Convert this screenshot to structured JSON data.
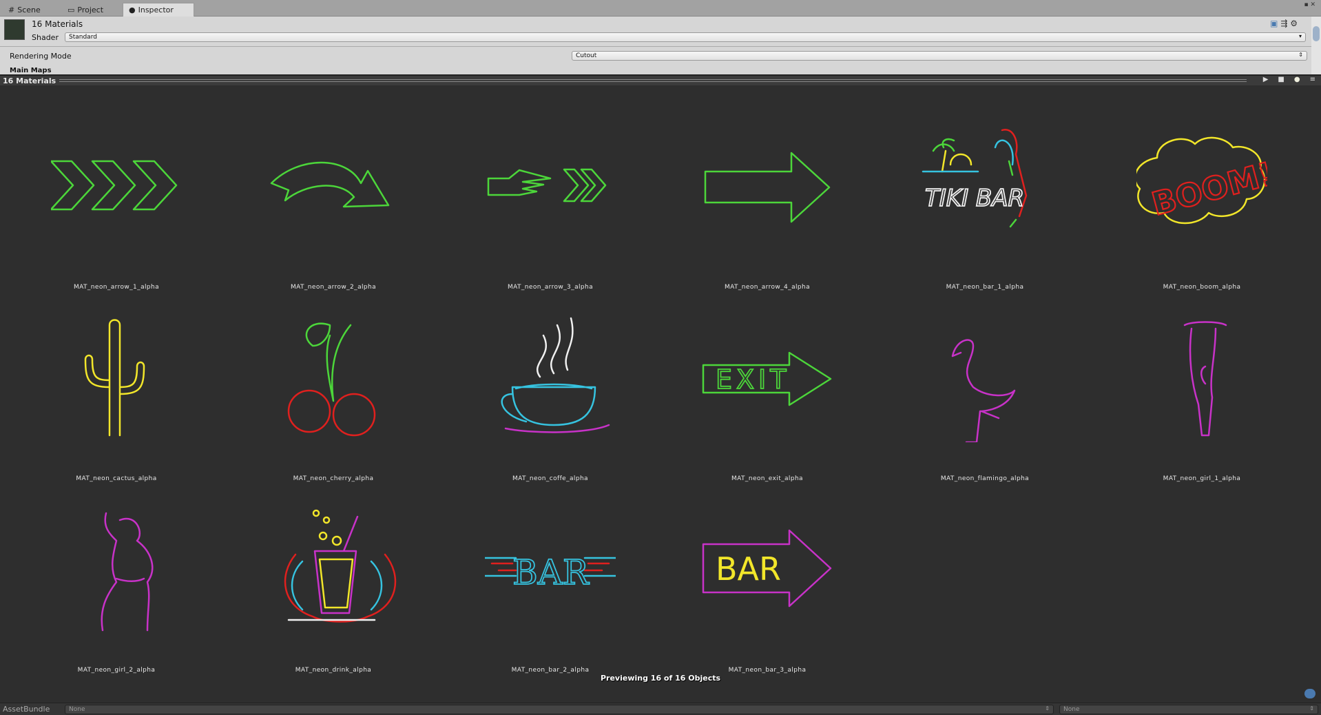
{
  "tabs": [
    {
      "label": "Scene",
      "icon": "hash-icon"
    },
    {
      "label": "Project",
      "icon": "folder-icon"
    },
    {
      "label": "Inspector",
      "icon": "info-icon"
    }
  ],
  "inspector": {
    "title": "16 Materials",
    "shader_label": "Shader",
    "shader_value": "Standard",
    "rendering_mode_label": "Rendering Mode",
    "rendering_mode_value": "Cutout",
    "section": "Main Maps"
  },
  "preview": {
    "title": "16 Materials",
    "footer": "Previewing 16 of 16 Objects"
  },
  "materials": [
    {
      "name": "MAT_neon_arrow_1_alpha"
    },
    {
      "name": "MAT_neon_arrow_2_alpha"
    },
    {
      "name": "MAT_neon_arrow_3_alpha"
    },
    {
      "name": "MAT_neon_arrow_4_alpha"
    },
    {
      "name": "MAT_neon_bar_1_alpha",
      "text": "TIKI BAR"
    },
    {
      "name": "MAT_neon_boom_alpha",
      "text": "BOOM!"
    },
    {
      "name": "MAT_neon_cactus_alpha"
    },
    {
      "name": "MAT_neon_cherry_alpha"
    },
    {
      "name": "MAT_neon_coffe_alpha"
    },
    {
      "name": "MAT_neon_exit_alpha",
      "text": "EXIT"
    },
    {
      "name": "MAT_neon_flamingo_alpha"
    },
    {
      "name": "MAT_neon_girl_1_alpha"
    },
    {
      "name": "MAT_neon_girl_2_alpha"
    },
    {
      "name": "MAT_neon_drink_alpha"
    },
    {
      "name": "MAT_neon_bar_2_alpha",
      "text": "BAR"
    },
    {
      "name": "MAT_neon_bar_3_alpha",
      "text": "BAR"
    }
  ],
  "asset_bundle": {
    "label": "AssetBundle",
    "value": "None",
    "variant": "None"
  },
  "colors": {
    "green": "#4cd63a",
    "yellow": "#f2e62a",
    "red": "#e0201e",
    "cyan": "#36c3e0",
    "magenta": "#c832c8",
    "white": "#f0f0f0"
  }
}
